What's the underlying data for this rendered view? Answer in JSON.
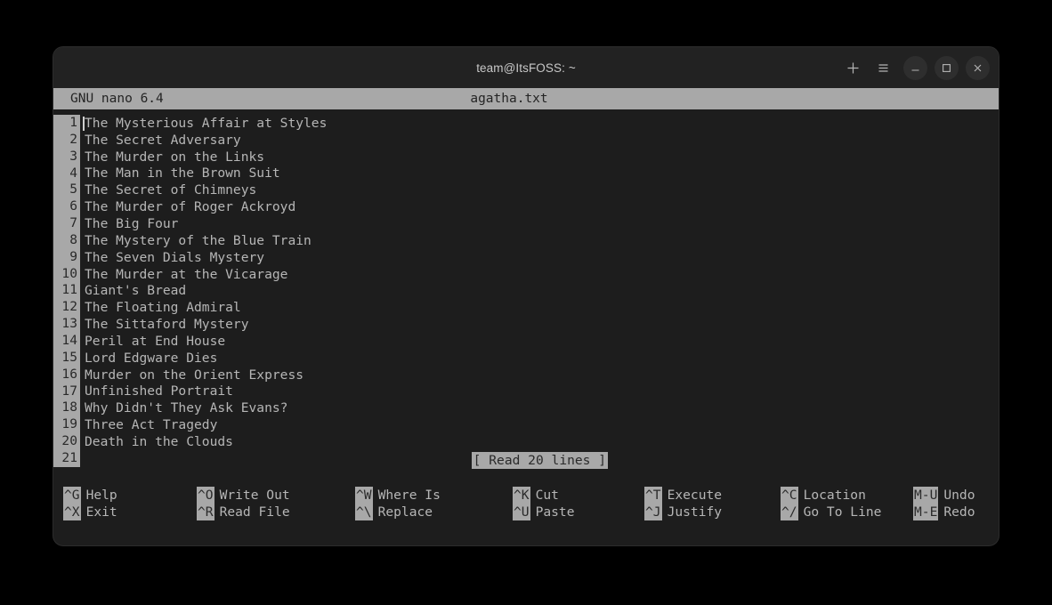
{
  "window": {
    "title": "team@ItsFOSS: ~",
    "controls": [
      {
        "name": "new-tab-button",
        "icon": "plus-icon"
      },
      {
        "name": "menu-button",
        "icon": "hamburger-icon"
      },
      {
        "name": "minimize-button",
        "icon": "minimize-icon"
      },
      {
        "name": "maximize-button",
        "icon": "maximize-icon"
      },
      {
        "name": "close-button",
        "icon": "close-icon"
      }
    ]
  },
  "nano": {
    "version": "GNU nano 6.4",
    "filename": "agatha.txt",
    "status_message": "[ Read 20 lines ]",
    "lines": [
      {
        "number": "1",
        "text": "The Mysterious Affair at Styles"
      },
      {
        "number": "2",
        "text": "The Secret Adversary"
      },
      {
        "number": "3",
        "text": "The Murder on the Links"
      },
      {
        "number": "4",
        "text": "The Man in the Brown Suit"
      },
      {
        "number": "5",
        "text": "The Secret of Chimneys"
      },
      {
        "number": "6",
        "text": "The Murder of Roger Ackroyd"
      },
      {
        "number": "7",
        "text": "The Big Four"
      },
      {
        "number": "8",
        "text": "The Mystery of the Blue Train"
      },
      {
        "number": "9",
        "text": "The Seven Dials Mystery"
      },
      {
        "number": "10",
        "text": "The Murder at the Vicarage"
      },
      {
        "number": "11",
        "text": "Giant's Bread"
      },
      {
        "number": "12",
        "text": "The Floating Admiral"
      },
      {
        "number": "13",
        "text": "The Sittaford Mystery"
      },
      {
        "number": "14",
        "text": "Peril at End House"
      },
      {
        "number": "15",
        "text": "Lord Edgware Dies"
      },
      {
        "number": "16",
        "text": "Murder on the Orient Express"
      },
      {
        "number": "17",
        "text": "Unfinished Portrait"
      },
      {
        "number": "18",
        "text": "Why Didn't They Ask Evans?"
      },
      {
        "number": "19",
        "text": "Three Act Tragedy"
      },
      {
        "number": "20",
        "text": "Death in the Clouds"
      },
      {
        "number": "21",
        "text": ""
      }
    ],
    "shortcuts": {
      "row1": [
        {
          "key": "^G",
          "label": "Help"
        },
        {
          "key": "^O",
          "label": "Write Out"
        },
        {
          "key": "^W",
          "label": "Where Is"
        },
        {
          "key": "^K",
          "label": "Cut"
        },
        {
          "key": "^T",
          "label": "Execute"
        },
        {
          "key": "^C",
          "label": "Location"
        },
        {
          "key": "M-U",
          "label": "Undo"
        }
      ],
      "row2": [
        {
          "key": "^X",
          "label": "Exit"
        },
        {
          "key": "^R",
          "label": "Read File"
        },
        {
          "key": "^\\",
          "label": "Replace"
        },
        {
          "key": "^U",
          "label": "Paste"
        },
        {
          "key": "^J",
          "label": "Justify"
        },
        {
          "key": "^/",
          "label": "Go To Line"
        },
        {
          "key": "M-E",
          "label": "Redo"
        }
      ]
    }
  },
  "colors": {
    "terminal_bg": "#1d1d1d",
    "titlebar_bg": "#222222",
    "highlight_bg": "#a8a8a8",
    "text_fg": "#b6b6b6",
    "page_bg": "#000000"
  }
}
